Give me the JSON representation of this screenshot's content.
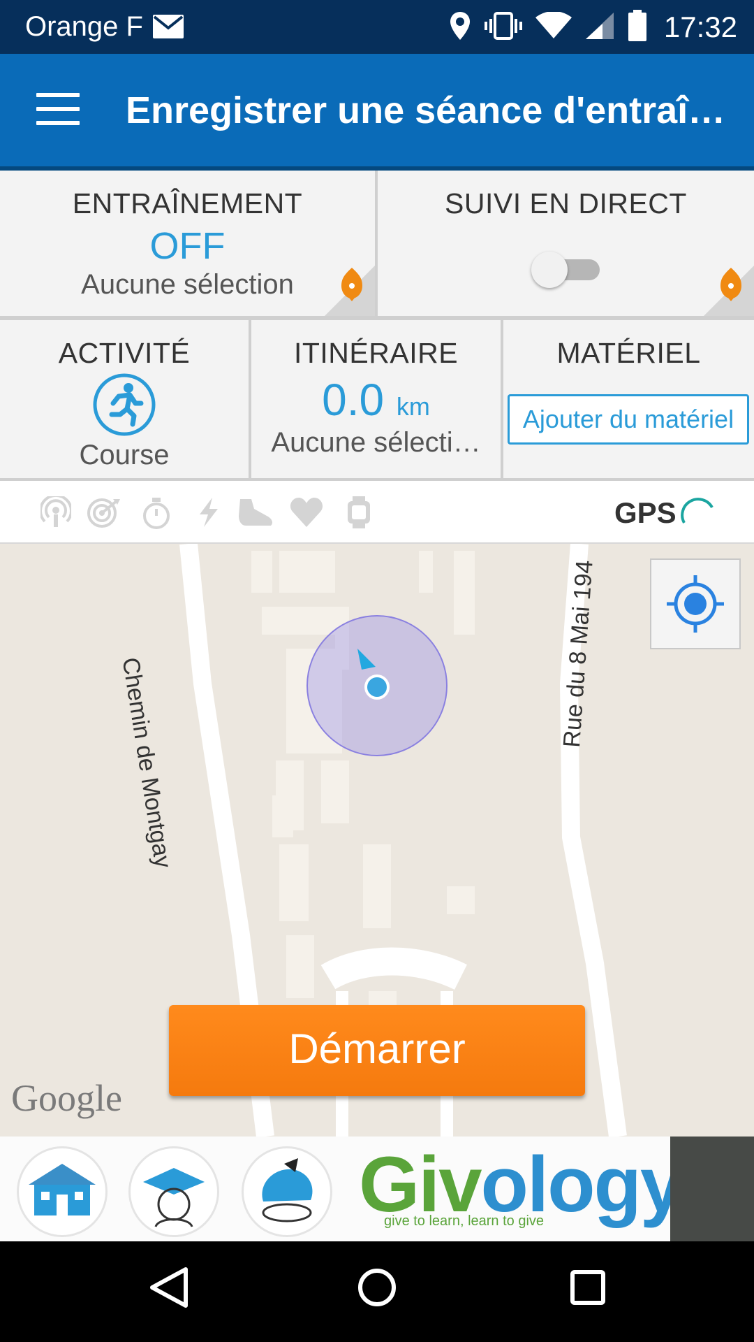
{
  "status_bar": {
    "carrier": "Orange F",
    "time": "17:32",
    "icons": [
      "mail-icon",
      "location-pin-icon",
      "vibrate-icon",
      "wifi-icon",
      "signal-icon",
      "battery-icon"
    ]
  },
  "app_bar": {
    "title": "Enregistrer une séance d'entraî…",
    "menu_icon": "hamburger-menu-icon"
  },
  "training": {
    "label": "ENTRAÎNEMENT",
    "value": "OFF",
    "subtitle": "Aucune sélection"
  },
  "live_tracking": {
    "label": "SUIVI EN DIRECT",
    "enabled": false
  },
  "activity": {
    "label": "ACTIVITÉ",
    "value": "Course",
    "icon": "running-person-icon"
  },
  "route": {
    "label": "ITINÉRAIRE",
    "distance": "0.0",
    "unit": "km",
    "subtitle": "Aucune sélecti…"
  },
  "equipment": {
    "label": "MATÉRIEL",
    "button": "Ajouter du matériel"
  },
  "sensors": {
    "icons": [
      "broadcast-icon",
      "target-icon",
      "stopwatch-icon",
      "lightning-icon",
      "shoe-icon",
      "heart-icon",
      "watch-icon"
    ],
    "gps_label": "GPS"
  },
  "map": {
    "street_1": "Chemin de Montgay",
    "street_2": "Rue du 8 Mai 194",
    "attribution": "Google",
    "start_button": "Démarrer"
  },
  "ad": {
    "brand": "Givology",
    "brand_part1": "Giv",
    "brand_part2": "ology",
    "tagline": "give to learn, learn to give"
  },
  "colors": {
    "status_bar": "#062f5b",
    "app_bar": "#0a6bb8",
    "accent_blue": "#2a9bd8",
    "start_orange": "#f57a0e",
    "pin_orange": "#f08a12"
  }
}
